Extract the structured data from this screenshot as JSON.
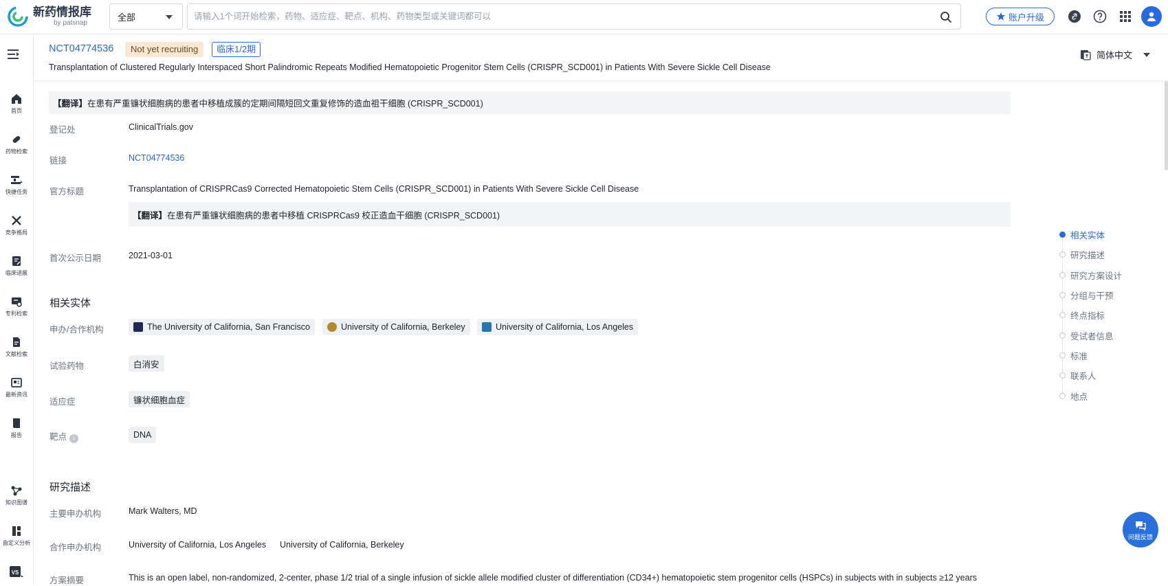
{
  "app": {
    "logo_title": "新药情报库",
    "logo_sub": "by patsnap",
    "brand_color": "#2a68e0"
  },
  "topbar": {
    "scope_value": "全部",
    "search_placeholder": "请输入1个词开始检索，药物、适应症、靶点、机构、药物类型或关键词都可以",
    "upgrade_label": "账户升级",
    "icons": [
      "link-icon",
      "help-icon",
      "apps-grid-icon",
      "user-avatar-icon"
    ]
  },
  "sidebar": {
    "items": [
      {
        "label": "首页",
        "icon": "home-icon"
      },
      {
        "label": "药物检索",
        "icon": "pill-icon"
      },
      {
        "label": "快捷任务",
        "icon": "task-icon"
      },
      {
        "label": "竞争格局",
        "icon": "swords-icon"
      },
      {
        "label": "临床进展",
        "icon": "clinical-icon"
      },
      {
        "label": "专利检索",
        "icon": "patent-icon"
      },
      {
        "label": "文献检索",
        "icon": "document-icon"
      },
      {
        "label": "最新资讯",
        "icon": "news-icon"
      },
      {
        "label": "报告",
        "icon": "report-icon"
      },
      {
        "label": "知识图谱",
        "icon": "graph-icon"
      },
      {
        "label": "自定义分析",
        "icon": "dashboard-icon"
      },
      {
        "label": "VS",
        "icon": "compare-icon"
      }
    ]
  },
  "header": {
    "nct_id": "NCT04774536",
    "status": "Not yet recruiting",
    "phase": "临床1/2期",
    "title": "Transplantation of Clustered Regularly Interspaced Short Palindromic Repeats Modified Hematopoietic Progenitor Stem Cells (CRISPR_SCD001) in Patients With Severe Sickle Cell Disease",
    "language": "简体中文"
  },
  "main": {
    "translation_prefix": "【翻译】",
    "title_translation": "在患有严重镰状细胞病的患者中移植成簇的定期间隔短回文重复修饰的造血祖干细胞 (CRISPR_SCD001)",
    "registry_label": "登记处",
    "registry_value": "ClinicalTrials.gov",
    "link_label": "链接",
    "link_value": "NCT04774536",
    "official_title_label": "官方标题",
    "official_title_value": "Transplantation of CRISPRCas9 Corrected Hematopoietic Stem Cells (CRISPR_SCD001) in Patients With Severe Sickle Cell Disease",
    "official_title_translation": "在患有严重镰状细胞病的患者中移植 CRISPRCas9 校正造血干细胞 (CRISPR_SCD001)",
    "first_posted_label": "首次公示日期",
    "first_posted_value": "2021-03-01",
    "related_entities_title": "相关实体",
    "sponsor_label": "申办/合作机构",
    "sponsors": [
      "The University of California, San Francisco",
      "University of California, Berkeley",
      "University of California, Los Angeles"
    ],
    "drug_label": "试验药物",
    "drug_value": "白消安",
    "indication_label": "适应症",
    "indication_value": "镰状细胞血症",
    "target_label": "靶点",
    "target_value": "DNA",
    "study_desc_title": "研究描述",
    "lead_sponsor_label": "主要申办机构",
    "lead_sponsor_value": "Mark Walters, MD",
    "collaborator_label": "合作申办机构",
    "collaborator_value_1": "University of California, Los Angeles",
    "collaborator_value_2": "University of California, Berkeley",
    "summary_label": "方案摘要",
    "summary_value": "This is an open label, non-randomized, 2-center, phase 1/2 trial of a single infusion of sickle allele modified cluster of differentiation (CD34+) hematopoietic stem progenitor cells (HSPCs) in subjects with in subjects ≥12 years"
  },
  "toc": {
    "items": [
      "相关实体",
      "研究描述",
      "研究方案设计",
      "分组与干预",
      "终点指标",
      "受试者信息",
      "标准",
      "联系人",
      "地点"
    ],
    "active_index": 0
  },
  "feedback": {
    "label": "问题反馈"
  }
}
